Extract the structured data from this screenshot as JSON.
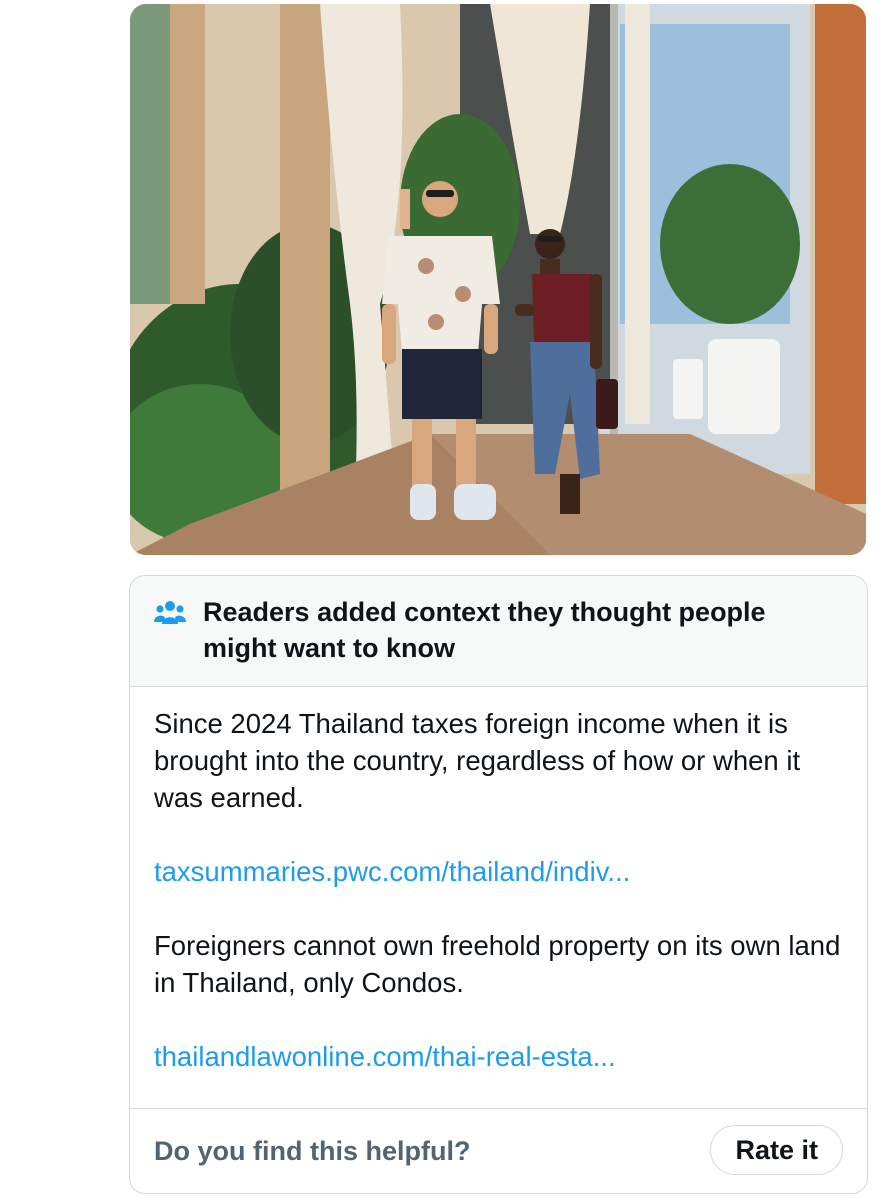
{
  "community_note": {
    "header": "Readers added context they thought people might want to know",
    "icon": "people-icon",
    "paragraph_1": "Since 2024 Thailand taxes foreign income when it is brought into the country, regardless of how or when it was earned.",
    "link_1": "taxsummaries.pwc.com/thailand/indiv...",
    "paragraph_2": "Foreigners cannot own freehold property on its own land in Thailand, only Condos.",
    "link_2": "thailandlawonline.com/thai-real-esta...",
    "helpful_question": "Do you find this helpful?",
    "rate_button": "Rate it"
  },
  "colors": {
    "link": "#1d9bf0",
    "icon": "#1d9bf0",
    "border": "#cfd9de",
    "muted_text": "#536471",
    "header_bg": "#f7f9f9"
  }
}
